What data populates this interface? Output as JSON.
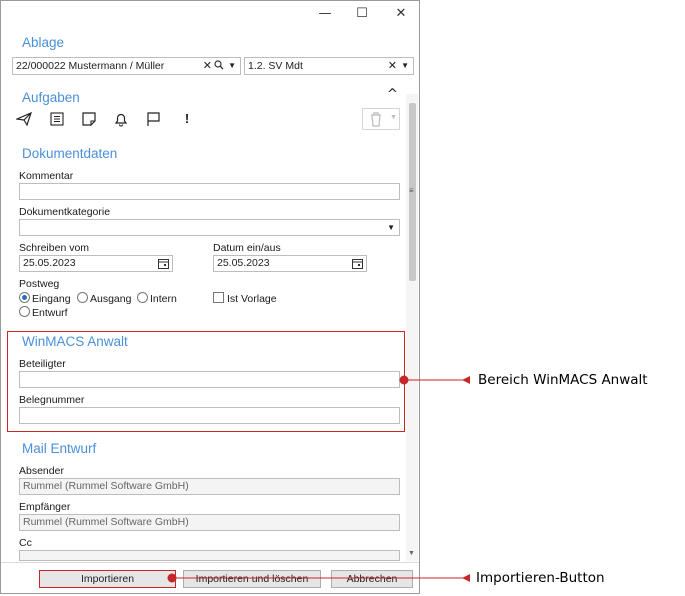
{
  "window": {
    "minimize": "—",
    "maximize": "☐",
    "close": "✕"
  },
  "ablage": {
    "title": "Ablage",
    "akte_value": "22/000022 Mustermann / Müller",
    "sachbearbeiter_value": "1.2. SV Mdt"
  },
  "aufgaben": {
    "title": "Aufgaben",
    "collapse": "^"
  },
  "dokumentdaten": {
    "title": "Dokumentdaten",
    "kommentar_label": "Kommentar",
    "kommentar_value": "",
    "kategorie_label": "Dokumentkategorie",
    "kategorie_value": "",
    "schreiben_label": "Schreiben vom",
    "schreiben_value": "25.05.2023",
    "datum_label": "Datum ein/aus",
    "datum_value": "25.05.2023",
    "postweg_label": "Postweg",
    "postweg_options": [
      "Eingang",
      "Ausgang",
      "Intern",
      "Entwurf"
    ],
    "postweg_selected": "Eingang",
    "vorlage_label": "Ist Vorlage"
  },
  "winmacs": {
    "title": "WinMACS Anwalt",
    "beteiligter_label": "Beteiligter",
    "beteiligter_value": "",
    "belegnummer_label": "Belegnummer",
    "belegnummer_value": ""
  },
  "mail": {
    "title": "Mail Entwurf",
    "absender_label": "Absender",
    "absender_value": "Rummel (Rummel Software GmbH)",
    "empfaenger_label": "Empfänger",
    "empfaenger_value": "Rummel (Rummel Software GmbH)",
    "cc_label": "Cc",
    "cc_value": ""
  },
  "buttons": {
    "import": "Importieren",
    "import_delete": "Importieren und löschen",
    "cancel": "Abbrechen"
  },
  "callouts": {
    "winmacs": "Bereich WinMACS Anwalt",
    "import": "Importieren-Button"
  },
  "colors": {
    "section": "#4a90d9",
    "callout": "#c62828",
    "scroll_thumb": "#c8c8c8"
  }
}
